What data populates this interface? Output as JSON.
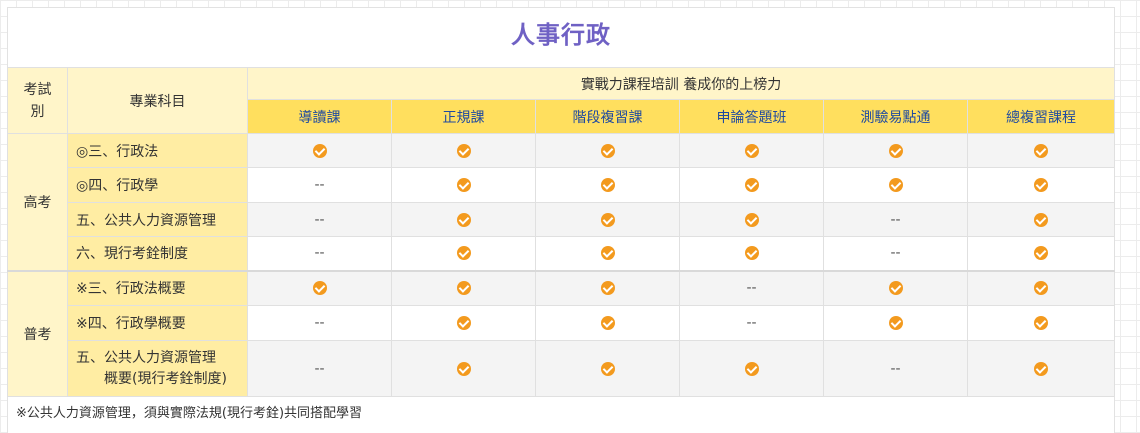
{
  "title": "人事行政",
  "header": {
    "category": "考試別",
    "subject": "專業科目",
    "banner": "實戰力課程培訓 養成你的上榜力",
    "courses": [
      "導讀課",
      "正規課",
      "階段複習課",
      "申論答題班",
      "測驗易點通",
      "總複習課程"
    ]
  },
  "groups": [
    {
      "name": "高考",
      "rows": [
        {
          "subject": "◎三、行政法",
          "cells": [
            "check",
            "check",
            "check",
            "check",
            "check",
            "check"
          ]
        },
        {
          "subject": "◎四、行政學",
          "cells": [
            "--",
            "check",
            "check",
            "check",
            "check",
            "check"
          ]
        },
        {
          "subject": "五、公共人力資源管理",
          "cells": [
            "--",
            "check",
            "check",
            "check",
            "--",
            "check"
          ]
        },
        {
          "subject": "六、現行考銓制度",
          "cells": [
            "--",
            "check",
            "check",
            "check",
            "--",
            "check"
          ]
        }
      ]
    },
    {
      "name": "普考",
      "rows": [
        {
          "subject": "※三、行政法概要",
          "cells": [
            "check",
            "check",
            "check",
            "--",
            "check",
            "check"
          ]
        },
        {
          "subject": "※四、行政學概要",
          "cells": [
            "--",
            "check",
            "check",
            "--",
            "check",
            "check"
          ]
        },
        {
          "subject": "五、公共人力資源管理",
          "subject_line2": "概要(現行考銓制度)",
          "cells": [
            "--",
            "check",
            "check",
            "check",
            "--",
            "check"
          ]
        }
      ]
    }
  ],
  "dash": "--",
  "icons": {
    "check": "check-circle-icon"
  },
  "colors": {
    "title": "#6f61c4",
    "check": "#f39a1e",
    "header_gold": "#ffdf5e",
    "header_light": "#fff5c9",
    "subject_bg": "#ffeda3",
    "course_text": "#1f4aa0"
  },
  "note": "※公共人力資源管理，須與實際法規(現行考銓)共同搭配學習"
}
